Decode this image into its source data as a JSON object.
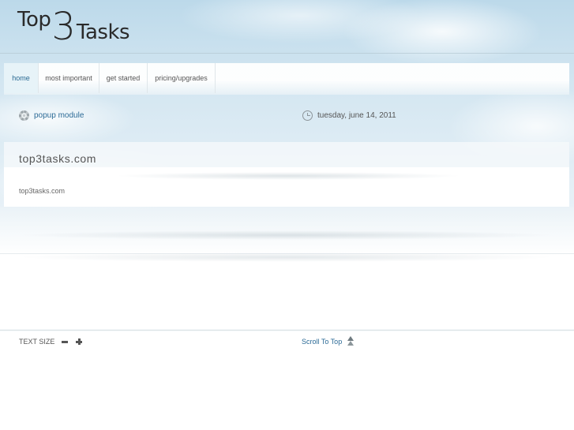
{
  "header": {
    "logo": {
      "part1": "Top",
      "part2": "3",
      "part3": "Tasks"
    }
  },
  "nav": {
    "items": [
      {
        "label": "home",
        "active": true
      },
      {
        "label": "most important",
        "active": false
      },
      {
        "label": "get started",
        "active": false
      },
      {
        "label": "pricing/upgrades",
        "active": false
      }
    ]
  },
  "toolbar": {
    "popup_label": "popup module",
    "popup_icon": "gear-icon",
    "date": "tuesday, june 14, 2011",
    "date_icon": "clock-icon"
  },
  "main": {
    "title": "top3tasks.com",
    "body": "top3tasks.com"
  },
  "footer": {
    "text_size_label": "TEXT SIZE",
    "scroll_label": "Scroll To Top"
  },
  "colors": {
    "link": "#2b6a96",
    "text": "#555555",
    "sky": "#bcd9ea"
  }
}
